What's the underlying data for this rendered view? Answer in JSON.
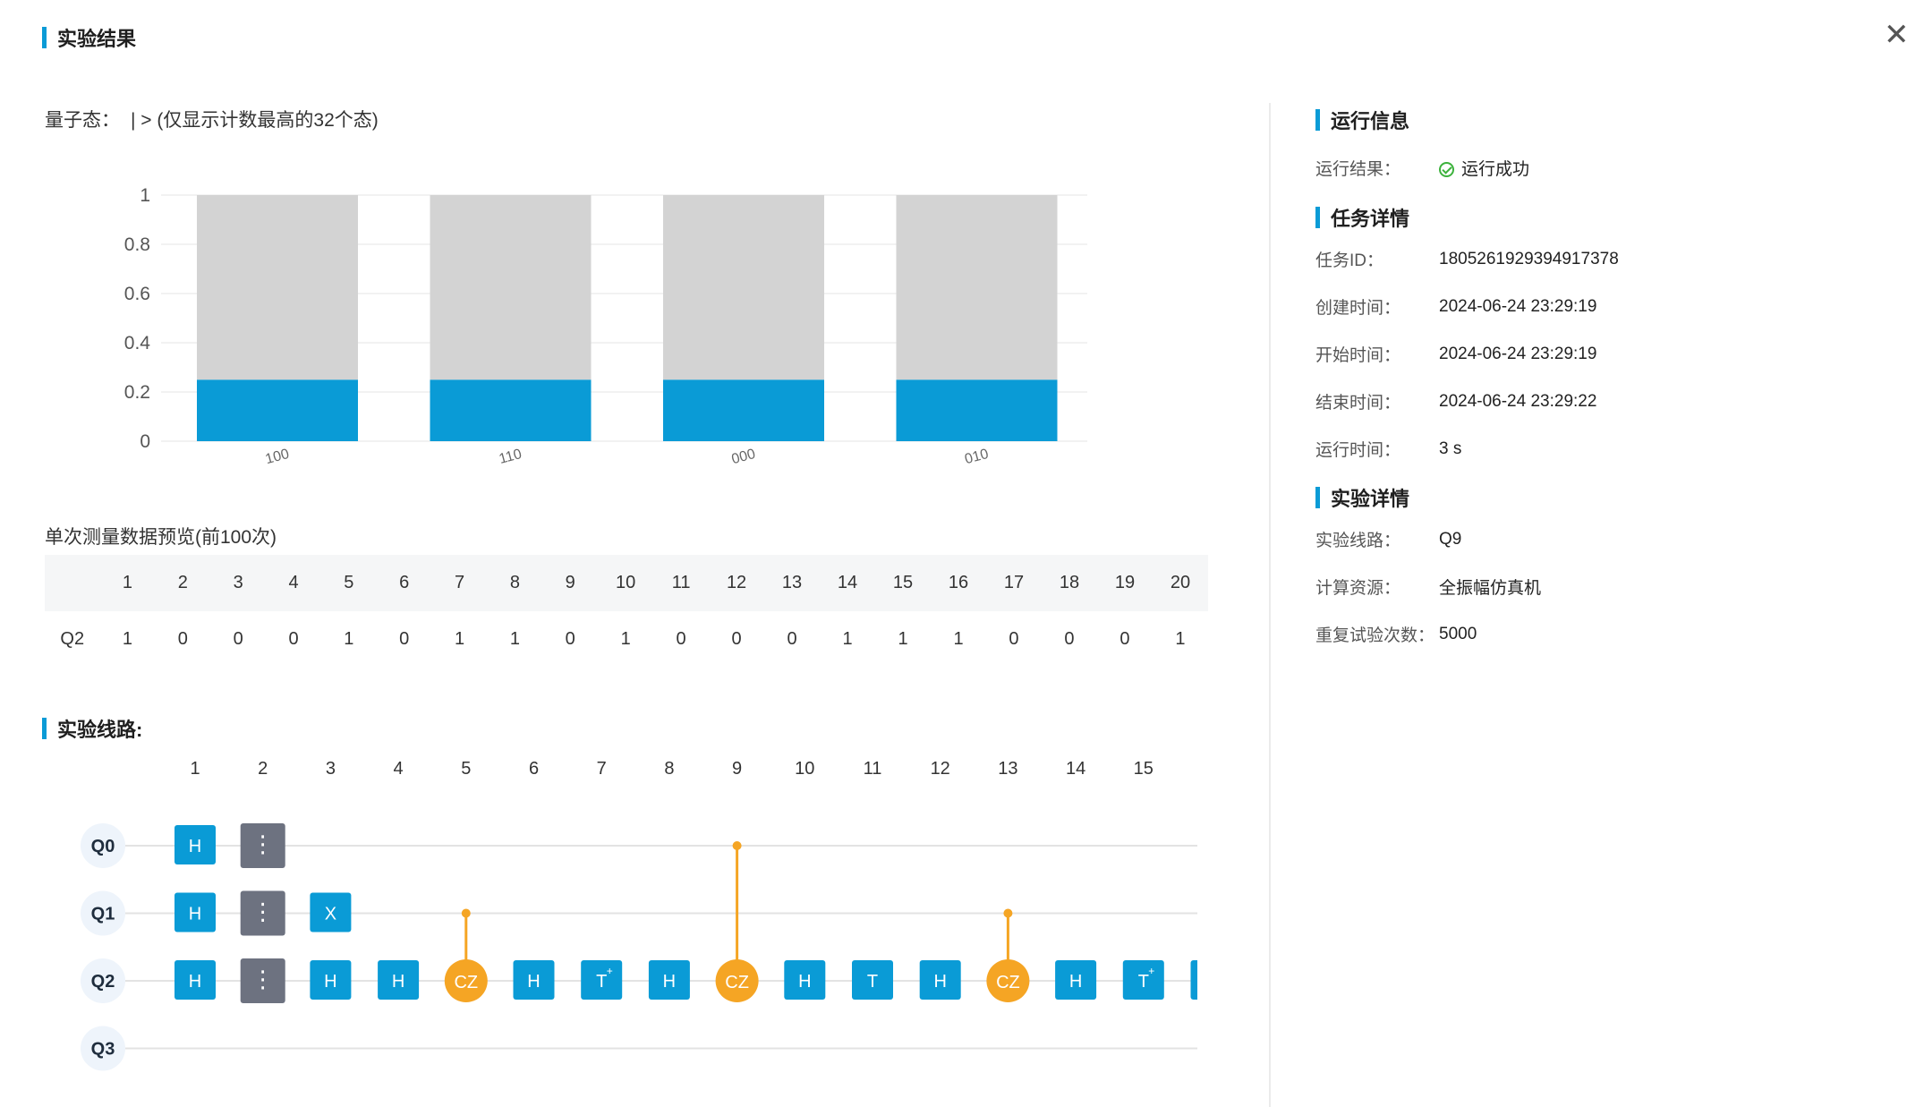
{
  "header": {
    "title": "实验结果",
    "close_icon": "close-icon"
  },
  "quantum_state": {
    "label": "量子态：",
    "ket": "| >",
    "note": "(仅显示计数最高的32个态)"
  },
  "chart_data": {
    "type": "bar",
    "categories": [
      "100",
      "110",
      "000",
      "010"
    ],
    "series": [
      {
        "values": [
          0.25,
          0.25,
          0.25,
          0.25
        ],
        "color": "#0a9bd6"
      },
      {
        "values": [
          0.75,
          0.75,
          0.75,
          0.75
        ],
        "color": "#d3d3d3"
      }
    ],
    "stacked": true,
    "ylim": [
      0,
      1
    ],
    "yticks": [
      "0",
      "0.2",
      "0.4",
      "0.6",
      "0.8",
      "1"
    ],
    "grid": true
  },
  "measurement": {
    "title": "单次测量数据预览(前100次)",
    "columns": [
      "1",
      "2",
      "3",
      "4",
      "5",
      "6",
      "7",
      "8",
      "9",
      "10",
      "11",
      "12",
      "13",
      "14",
      "15",
      "16",
      "17",
      "18",
      "19",
      "20"
    ],
    "row_label": "Q2",
    "values": [
      "1",
      "0",
      "0",
      "0",
      "1",
      "0",
      "1",
      "1",
      "0",
      "1",
      "0",
      "0",
      "0",
      "1",
      "1",
      "1",
      "0",
      "0",
      "0",
      "1"
    ]
  },
  "circuit": {
    "title": "实验线路:",
    "columns": [
      "1",
      "2",
      "3",
      "4",
      "5",
      "6",
      "7",
      "8",
      "9",
      "10",
      "11",
      "12",
      "13",
      "14",
      "15"
    ],
    "qubits": [
      "Q0",
      "Q1",
      "Q2",
      "Q3"
    ],
    "colors": {
      "gate": "#0a9bd6",
      "barrier": "#6d7280",
      "cz": "#f5a524"
    },
    "gates": [
      {
        "type": "gate",
        "label": "H",
        "q": 0,
        "col": 1
      },
      {
        "type": "gate",
        "label": "H",
        "q": 1,
        "col": 1
      },
      {
        "type": "gate",
        "label": "H",
        "q": 2,
        "col": 1
      },
      {
        "type": "barrier",
        "label": "⋮",
        "q": 0,
        "col": 2
      },
      {
        "type": "barrier",
        "label": "⋮",
        "q": 1,
        "col": 2
      },
      {
        "type": "barrier",
        "label": "⋮",
        "q": 2,
        "col": 2
      },
      {
        "type": "gate",
        "label": "X",
        "q": 1,
        "col": 3
      },
      {
        "type": "gate",
        "label": "H",
        "q": 2,
        "col": 3
      },
      {
        "type": "gate",
        "label": "H",
        "q": 2,
        "col": 4
      },
      {
        "type": "cz",
        "label": "CZ",
        "q": 2,
        "col": 5,
        "control": 1
      },
      {
        "type": "gate",
        "label": "H",
        "q": 2,
        "col": 6
      },
      {
        "type": "gate",
        "label": "T",
        "sup": "+",
        "q": 2,
        "col": 7
      },
      {
        "type": "gate",
        "label": "H",
        "q": 2,
        "col": 8
      },
      {
        "type": "cz",
        "label": "CZ",
        "q": 2,
        "col": 9,
        "control": 0
      },
      {
        "type": "gate",
        "label": "H",
        "q": 2,
        "col": 10
      },
      {
        "type": "gate",
        "label": "T",
        "q": 2,
        "col": 11
      },
      {
        "type": "gate",
        "label": "H",
        "q": 2,
        "col": 12
      },
      {
        "type": "cz",
        "label": "CZ",
        "q": 2,
        "col": 13,
        "control": 1
      },
      {
        "type": "gate",
        "label": "H",
        "q": 2,
        "col": 14
      },
      {
        "type": "gate",
        "label": "T",
        "sup": "+",
        "q": 2,
        "col": 15
      },
      {
        "type": "gate",
        "label": "",
        "q": 2,
        "col": 16
      }
    ]
  },
  "run_info": {
    "title": "运行信息",
    "result_label": "运行结果：",
    "result_value": "运行成功",
    "result_icon": "check-circle-icon"
  },
  "task_details": {
    "title": "任务详情",
    "rows": [
      {
        "k": "任务ID：",
        "v": "1805261929394917378"
      },
      {
        "k": "创建时间：",
        "v": "2024-06-24 23:29:19"
      },
      {
        "k": "开始时间：",
        "v": "2024-06-24 23:29:19"
      },
      {
        "k": "结束时间：",
        "v": "2024-06-24 23:29:22"
      },
      {
        "k": "运行时间：",
        "v": "3 s"
      }
    ]
  },
  "experiment_details": {
    "title": "实验详情",
    "rows": [
      {
        "k": "实验线路：",
        "v": "Q9"
      },
      {
        "k": "计算资源：",
        "v": "全振幅仿真机"
      },
      {
        "k": "重复试验次数：",
        "v": "5000"
      }
    ]
  }
}
